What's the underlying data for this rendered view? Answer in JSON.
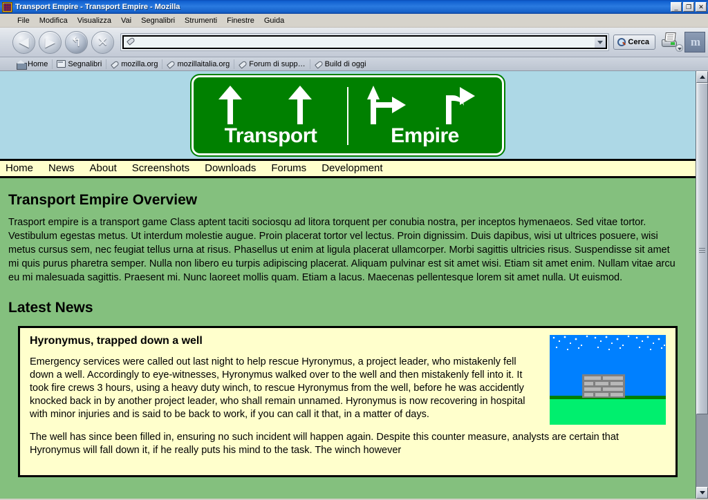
{
  "window": {
    "title": "Transport Empire - Transport Empire - Mozilla",
    "app_icon": "transport-empire-icon",
    "buttons": {
      "minimize": "_",
      "restore": "❐",
      "close": "✕"
    }
  },
  "menubar": {
    "items": [
      "File",
      "Modifica",
      "Visualizza",
      "Vai",
      "Segnalibri",
      "Strumenti",
      "Finestre",
      "Guida"
    ]
  },
  "toolbar": {
    "back": "◀",
    "forward": "▶",
    "reload": "↰",
    "stop": "✕",
    "search_label": "Cerca",
    "print_icon": "print-icon",
    "mozilla_logo": "m"
  },
  "urlbar": {
    "value": "",
    "placeholder": "",
    "icon": "bookmark-tag-icon",
    "dropdown": "chevron-down-icon"
  },
  "bookmarks": {
    "items": [
      {
        "label": "Home",
        "icon": "home-icon"
      },
      {
        "label": "Segnalibri",
        "icon": "folder-icon"
      },
      {
        "label": "mozilla.org",
        "icon": "bookmark-tag-icon"
      },
      {
        "label": "mozillaitalia.org",
        "icon": "bookmark-tag-icon"
      },
      {
        "label": "Forum di supp…",
        "icon": "bookmark-tag-icon"
      },
      {
        "label": "Build di oggi",
        "icon": "bookmark-tag-icon"
      }
    ]
  },
  "page": {
    "banner": {
      "left_text": "Transport",
      "right_text": "Empire",
      "background_color": "#add8e6",
      "sign_color": "#008000"
    },
    "nav": {
      "items": [
        "Home",
        "News",
        "About",
        "Screenshots",
        "Downloads",
        "Forums",
        "Development"
      ]
    },
    "overview": {
      "heading": "Transport Empire Overview",
      "body": "Trasport empire is a transport game Class aptent taciti sociosqu ad litora torquent per conubia nostra, per inceptos hymenaeos. Sed vitae tortor. Vestibulum egestas metus. Ut interdum molestie augue. Proin placerat tortor vel lectus. Proin dignissim. Duis dapibus, wisi ut ultrices posuere, wisi metus cursus sem, nec feugiat tellus urna at risus. Phasellus ut enim at ligula placerat ullamcorper. Morbi sagittis ultricies risus. Suspendisse sit amet mi quis purus pharetra semper. Nulla non libero eu turpis adipiscing placerat. Aliquam pulvinar est sit amet wisi. Etiam sit amet enim. Nullam vitae arcu eu mi malesuada sagittis. Praesent mi. Nunc laoreet mollis quam. Etiam a lacus. Maecenas pellentesque lorem sit amet nulla. Ut euismod."
    },
    "news": {
      "heading": "Latest News",
      "article_title": "Hyronymus, trapped down a well",
      "paragraph_1": "Emergency services were called out last night to help rescue Hyronymus, a project leader, who mistakenly fell down a well. Accordingly to eye-witnesses, Hyronymus walked over to the well and then mistakenly fell into it. It took fire crews 3 hours, using a heavy duty winch, to rescue Hyronymus from the well, before he was accidently knocked back in by another project leader, who shall remain unnamed. Hyronymus is now recovering in hospital with minor injuries and is said to be back to work, if you can call it that, in a matter of days.",
      "paragraph_2": "The well has since been filled in, ensuring no such incident will happen again. Despite this counter measure, analysts are certain that Hyronymus will fall down it, if he really puts his mind to the task. The winch however",
      "figure_alt": "well-illustration"
    },
    "colors": {
      "page_background": "#84c07e",
      "nav_background": "#ffffcc",
      "newsbox_background": "#ffffcc",
      "sky": "#0080ff",
      "grass": "#00ef6e"
    }
  },
  "scrollbar": {
    "up": "▲",
    "down": "▼",
    "thumb_position_percent": 0
  }
}
